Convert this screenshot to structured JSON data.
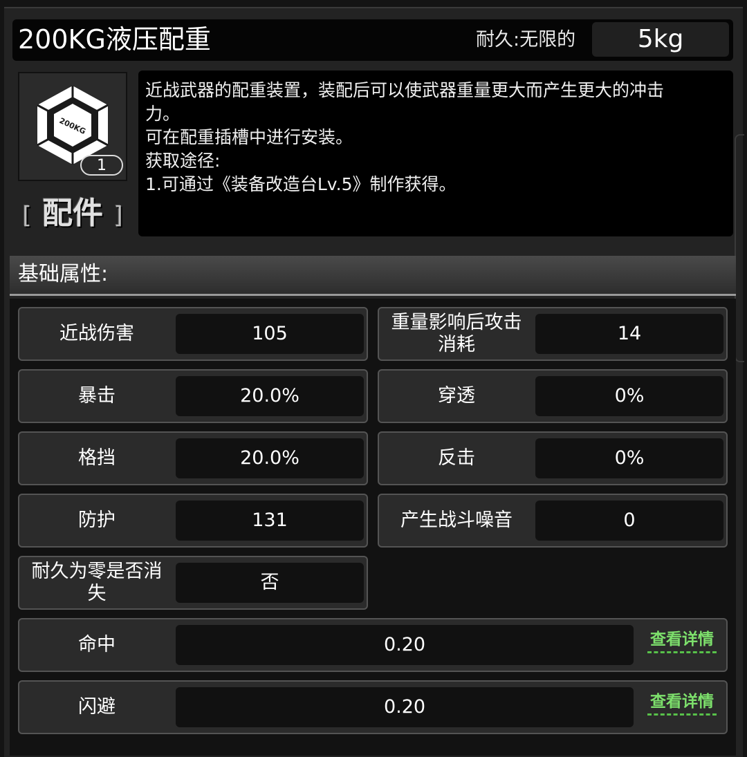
{
  "item": {
    "name": "200KG液压配重",
    "durability_label": "耐久:无限的",
    "weight": "5kg",
    "icon_text": "200KG",
    "count": "1",
    "category": "配件",
    "bracket_open": "[",
    "bracket_close": "]"
  },
  "description": {
    "lines": [
      "近战武器的配重装置，装配后可以使武器重量更大而产生更大的冲击",
      "力。",
      "可在配重插槽中进行安装。",
      "获取途径:",
      "1.可通过《装备改造台Lv.5》制作获得。"
    ]
  },
  "section": {
    "title": "基础属性:"
  },
  "stats": {
    "melee_damage": {
      "label": "近战伤害",
      "value": "105"
    },
    "attack_cost": {
      "label": "重量影响后攻击消耗",
      "value": "14"
    },
    "critical": {
      "label": "暴击",
      "value": "20.0%"
    },
    "penetration": {
      "label": "穿透",
      "value": "0%"
    },
    "block": {
      "label": "格挡",
      "value": "20.0%"
    },
    "counter": {
      "label": "反击",
      "value": "0%"
    },
    "defense": {
      "label": "防护",
      "value": "131"
    },
    "noise": {
      "label": "产生战斗噪音",
      "value": "0"
    },
    "vanish": {
      "label": "耐久为零是否消失",
      "value": "否"
    },
    "hit": {
      "label": "命中",
      "value": "0.20",
      "link": "查看详情"
    },
    "dodge": {
      "label": "闪避",
      "value": "0.20",
      "link": "查看详情"
    }
  },
  "colors": {
    "link_green": "#7de06c",
    "panel": "#2b2b2b",
    "value_bg": "#111111"
  }
}
